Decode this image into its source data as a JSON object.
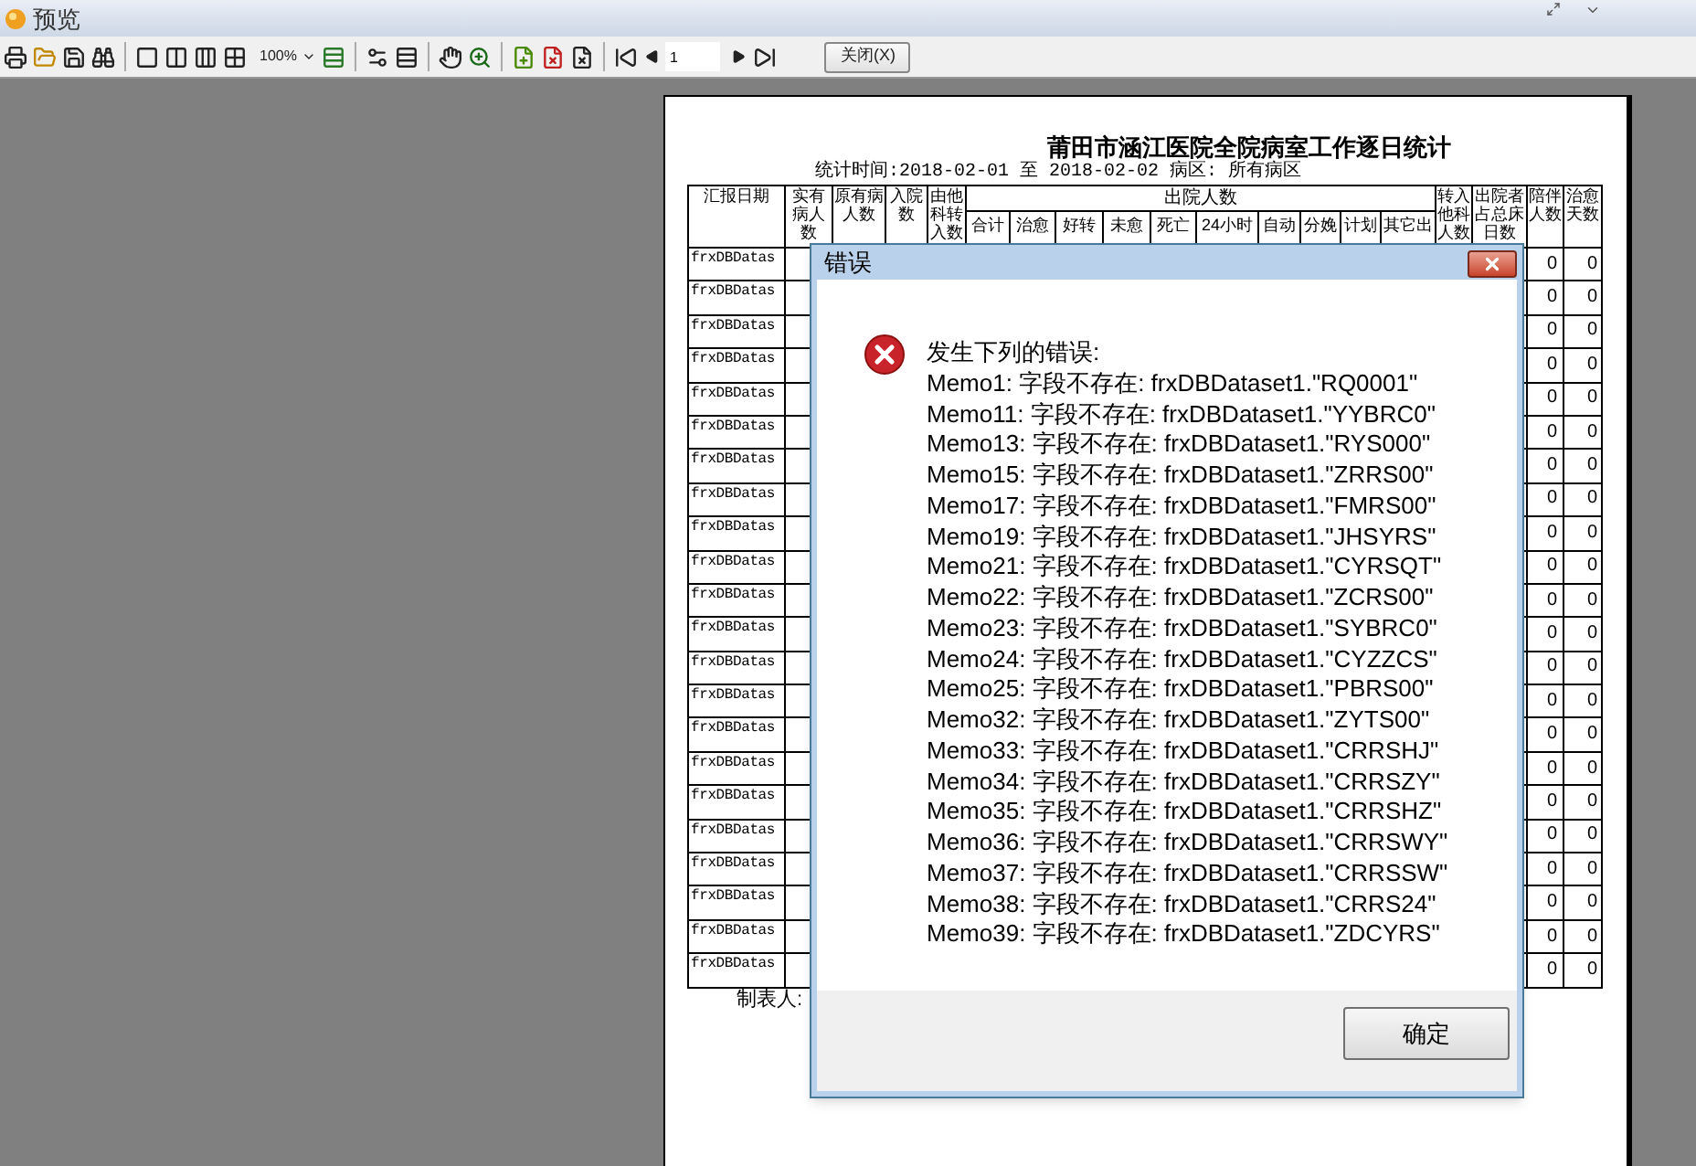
{
  "window": {
    "title": "预览"
  },
  "toolbar": {
    "zoom": "100%",
    "page": "1",
    "close_button": "关闭(X)"
  },
  "report": {
    "title": "莆田市涵江医院全院病室工作逐日统计",
    "subtitle": "统计时间:2018-02-01 至 2018-02-02 病区: 所有病区",
    "columns": [
      {
        "label": "汇报日期"
      },
      {
        "label": "实有病人数"
      },
      {
        "label": "原有病人数"
      },
      {
        "label": "入院数"
      },
      {
        "label": "由他科转入数"
      },
      {
        "label": "出院人数",
        "children": [
          "合计",
          "治愈",
          "好转",
          "未愈",
          "死亡",
          "24小时",
          "自动",
          "分娩",
          "计划",
          "其它出"
        ]
      },
      {
        "label": "转入他科人数"
      },
      {
        "label": "出院者占总床日数"
      },
      {
        "label": "陪伴人数"
      },
      {
        "label": "治愈天数"
      }
    ],
    "rows": [
      {
        "report_date": "frxDBDatas",
        "companions": "0",
        "cure_days": "0"
      },
      {
        "report_date": "frxDBDatas",
        "companions": "0",
        "cure_days": "0"
      },
      {
        "report_date": "frxDBDatas",
        "companions": "0",
        "cure_days": "0"
      },
      {
        "report_date": "frxDBDatas",
        "companions": "0",
        "cure_days": "0"
      },
      {
        "report_date": "frxDBDatas",
        "companions": "0",
        "cure_days": "0"
      },
      {
        "report_date": "frxDBDatas",
        "companions": "0",
        "cure_days": "0"
      },
      {
        "report_date": "frxDBDatas",
        "companions": "0",
        "cure_days": "0"
      },
      {
        "report_date": "frxDBDatas",
        "companions": "0",
        "cure_days": "0"
      },
      {
        "report_date": "frxDBDatas",
        "companions": "0",
        "cure_days": "0"
      },
      {
        "report_date": "frxDBDatas",
        "companions": "0",
        "cure_days": "0"
      },
      {
        "report_date": "frxDBDatas",
        "companions": "0",
        "cure_days": "0"
      },
      {
        "report_date": "frxDBDatas",
        "companions": "0",
        "cure_days": "0"
      },
      {
        "report_date": "frxDBDatas",
        "companions": "0",
        "cure_days": "0"
      },
      {
        "report_date": "frxDBDatas",
        "companions": "0",
        "cure_days": "0"
      },
      {
        "report_date": "frxDBDatas",
        "companions": "0",
        "cure_days": "0"
      },
      {
        "report_date": "frxDBDatas",
        "companions": "0",
        "cure_days": "0"
      },
      {
        "report_date": "frxDBDatas",
        "companions": "0",
        "cure_days": "0"
      },
      {
        "report_date": "frxDBDatas",
        "companions": "0",
        "cure_days": "0"
      },
      {
        "report_date": "frxDBDatas",
        "companions": "0",
        "cure_days": "0"
      },
      {
        "report_date": "frxDBDatas",
        "companions": "0",
        "cure_days": "0"
      },
      {
        "report_date": "frxDBDatas",
        "companions": "0",
        "cure_days": "0"
      },
      {
        "report_date": "frxDBDatas",
        "companions": "0",
        "cure_days": "0"
      }
    ],
    "footer": "制表人:"
  },
  "dialog": {
    "title": "错误",
    "heading": "发生下列的错误:",
    "messages": [
      "Memo1: 字段不存在: frxDBDataset1.\"RQ0001\"",
      "Memo11: 字段不存在: frxDBDataset1.\"YYBRC0\"",
      "Memo13: 字段不存在: frxDBDataset1.\"RYS000\"",
      "Memo15: 字段不存在: frxDBDataset1.\"ZRRS00\"",
      "Memo17: 字段不存在: frxDBDataset1.\"FMRS00\"",
      "Memo19: 字段不存在: frxDBDataset1.\"JHSYRS\"",
      "Memo21: 字段不存在: frxDBDataset1.\"CYRSQT\"",
      "Memo22: 字段不存在: frxDBDataset1.\"ZCRS00\"",
      "Memo23: 字段不存在: frxDBDataset1.\"SYBRC0\"",
      "Memo24: 字段不存在: frxDBDataset1.\"CYZZCS\"",
      "Memo25: 字段不存在: frxDBDataset1.\"PBRS00\"",
      "Memo32: 字段不存在: frxDBDataset1.\"ZYTS00\"",
      "Memo33: 字段不存在: frxDBDataset1.\"CRRSHJ\"",
      "Memo34: 字段不存在: frxDBDataset1.\"CRRSZY\"",
      "Memo35: 字段不存在: frxDBDataset1.\"CRRSHZ\"",
      "Memo36: 字段不存在: frxDBDataset1.\"CRRSWY\"",
      "Memo37: 字段不存在: frxDBDataset1.\"CRRSSW\"",
      "Memo38: 字段不存在: frxDBDataset1.\"CRRS24\"",
      "Memo39: 字段不存在: frxDBDataset1.\"ZDCYRS\""
    ],
    "ok_button": "确定"
  }
}
